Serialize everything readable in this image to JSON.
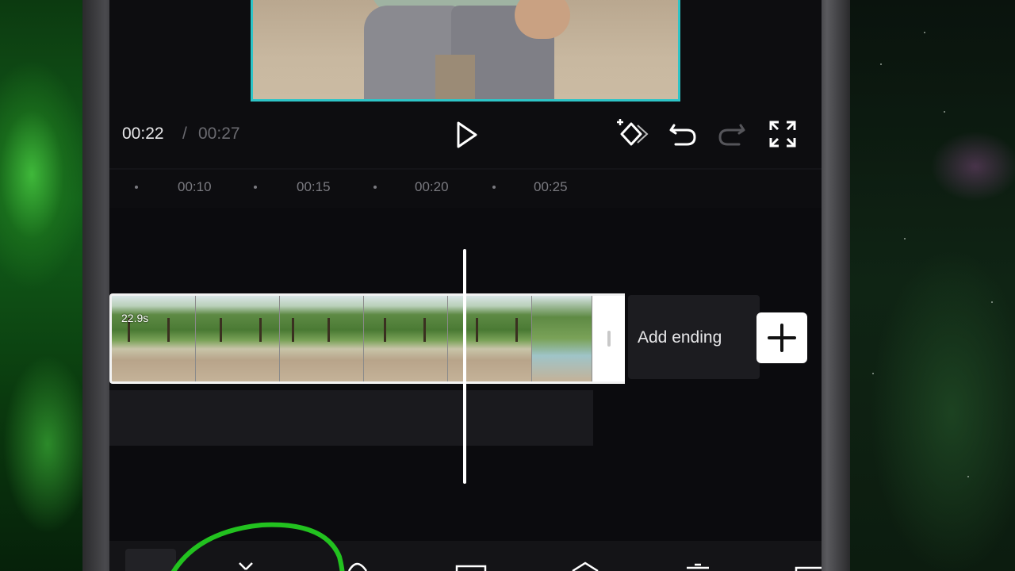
{
  "player": {
    "time_current": "00:22",
    "time_separator": "/",
    "time_total": "00:27"
  },
  "ruler": {
    "labels": [
      "00:10",
      "00:15",
      "00:20",
      "00:25"
    ]
  },
  "clip": {
    "duration": "22.9s"
  },
  "add_ending": {
    "label": "Add ending"
  },
  "icons": {
    "play": "play-icon",
    "keyframe": "keyframe-icon",
    "undo": "undo-icon",
    "redo": "redo-icon",
    "fullscreen": "fullscreen-icon",
    "add": "plus-icon"
  },
  "colors": {
    "preview_border": "#2ec4c7",
    "annotation": "#22c21f",
    "background": "#0d0d10"
  }
}
